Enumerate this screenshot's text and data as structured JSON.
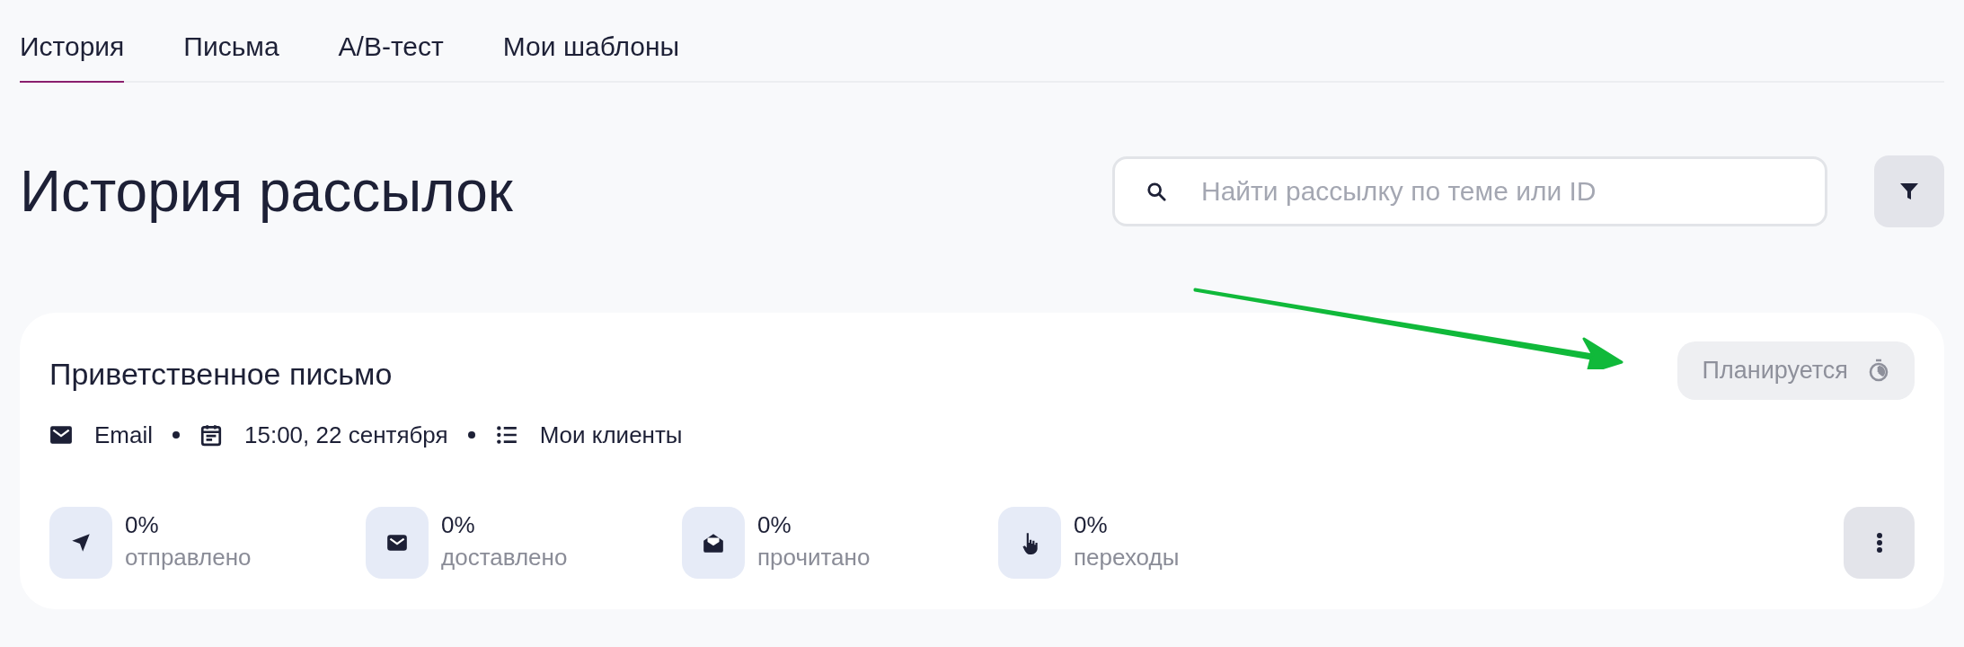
{
  "tabs": [
    {
      "label": "История",
      "selected": true
    },
    {
      "label": "Письма",
      "selected": false
    },
    {
      "label": "A/B-тест",
      "selected": false
    },
    {
      "label": "Мои шаблоны",
      "selected": false
    }
  ],
  "page_title": "История рассылок",
  "search": {
    "placeholder": "Найти рассылку по теме или ID"
  },
  "campaign": {
    "title": "Приветственное письмо",
    "status": "Планируется",
    "meta": [
      {
        "kind": "channel",
        "text": "Email"
      },
      {
        "kind": "date",
        "text": "15:00, 22 сентября"
      },
      {
        "kind": "audience",
        "text": "Мои клиенты"
      }
    ],
    "stats": [
      {
        "kind": "sent",
        "value": "0%",
        "label": "отправлено"
      },
      {
        "kind": "delivered",
        "value": "0%",
        "label": "доставлено"
      },
      {
        "kind": "read",
        "value": "0%",
        "label": "прочитано"
      },
      {
        "kind": "clicks",
        "value": "0%",
        "label": "переходы"
      }
    ]
  }
}
